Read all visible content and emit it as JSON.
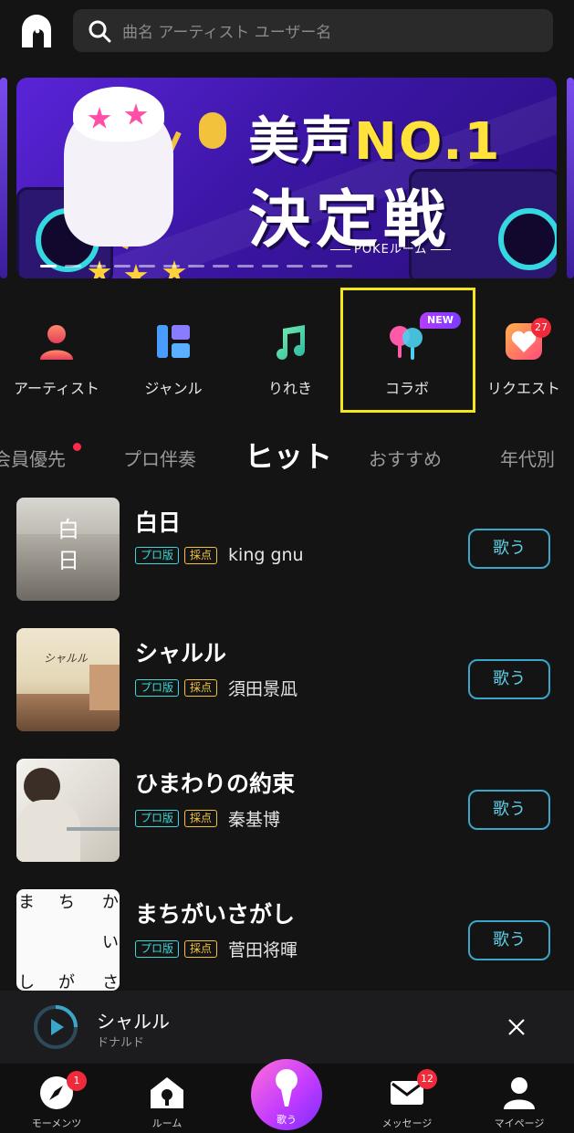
{
  "search": {
    "placeholder": "曲名 アーティスト ユーザー名"
  },
  "banner": {
    "line1_a": "美声",
    "line1_b": "NO.1",
    "line2": "決定戦",
    "caption": "POKEルーム"
  },
  "categories": [
    {
      "label": "アーティスト",
      "icon": "artist-icon"
    },
    {
      "label": "ジャンル",
      "icon": "genre-icon"
    },
    {
      "label": "りれき",
      "icon": "history-icon"
    },
    {
      "label": "コラボ",
      "icon": "collab-icon",
      "badge": "NEW"
    },
    {
      "label": "リクエスト",
      "icon": "request-icon",
      "badge": "27"
    }
  ],
  "tabs": [
    "会員優先",
    "プロ伴奏",
    "ヒット",
    "おすすめ",
    "年代別"
  ],
  "active_tab": "ヒット",
  "tag_labels": {
    "pro": "プロ版",
    "score": "採点"
  },
  "songs": [
    {
      "title": "白日",
      "artist": "king gnu",
      "button": "歌う"
    },
    {
      "title": "シャルル",
      "artist": "須田景凪",
      "button": "歌う"
    },
    {
      "title": "ひまわりの約束",
      "artist": "秦基博",
      "button": "歌う"
    },
    {
      "title": "まちがいさがし",
      "artist": "菅田将暉",
      "button": "歌う"
    }
  ],
  "thumb_text": {
    "hakujitsu": "白日",
    "charles": "シャルル",
    "machigai": [
      "ま",
      "ち",
      "か",
      "い",
      "し",
      "が",
      "さ"
    ]
  },
  "now_playing": {
    "title": "シャルル",
    "artist": "ドナルド"
  },
  "nav": [
    {
      "label": "モーメンツ",
      "icon": "compass-icon",
      "badge": "1"
    },
    {
      "label": "ルーム",
      "icon": "room-icon"
    },
    {
      "label": "歌う",
      "icon": "mic-icon"
    },
    {
      "label": "メッセージ",
      "icon": "mail-icon",
      "badge": "12"
    },
    {
      "label": "マイページ",
      "icon": "user-icon"
    }
  ],
  "colors": {
    "accent_cyan": "#3cd7d7",
    "highlight": "#f2e71b",
    "badge_red": "#f02a3a"
  }
}
